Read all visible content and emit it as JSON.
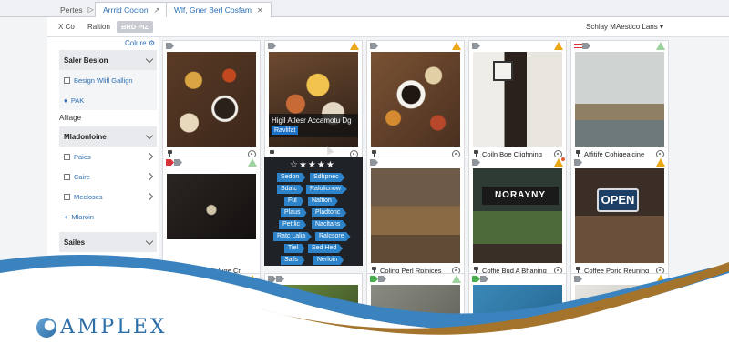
{
  "tabs": [
    {
      "label": "Pertes",
      "icon": "forward-icon"
    },
    {
      "label": "Arrrid Cocion",
      "icon": "forward-icon"
    },
    {
      "label": "Wlf, Gner Berl Cosfam",
      "icon": "close-icon"
    }
  ],
  "toolbar": {
    "undo_label": "X Co",
    "ration_label": "Raition",
    "pill_label": "BRD PIZ",
    "sort_label": "Schlay MAestico Lans"
  },
  "sidebar": {
    "top_link": "Colure",
    "panel1": {
      "title": "Saler Besion",
      "items": [
        {
          "label": "Besign Wlifl Gallign"
        },
        {
          "label": "PAK"
        }
      ]
    },
    "section_label": "Alliage",
    "panel2": {
      "title": "Mladonloine",
      "items": [
        {
          "label": "Paies"
        },
        {
          "label": "Caire"
        },
        {
          "label": "Mecloses"
        },
        {
          "label": "Mlaroin"
        }
      ]
    },
    "panel3": {
      "title": "Sailes"
    }
  },
  "cards": [
    {
      "caption": "",
      "photo": "food"
    },
    {
      "caption": "",
      "photo": "food2",
      "overlay_title": "Higil Atlesr Accamotu Dg",
      "overlay_tag": "Ravlifat"
    },
    {
      "caption": "",
      "photo": "coffee"
    },
    {
      "caption": "Coiln Boe Clighning",
      "photo": "woman"
    },
    {
      "caption": "Affitife Cohigealcine",
      "photo": "cliff"
    },
    {
      "caption": "Pstisng Compluge Cr",
      "photo": "dark"
    },
    {
      "caption": "Coling Perl Rpinices",
      "photo": "interior"
    },
    {
      "caption": "Coffie Bud A Bhaning",
      "photo": "plants",
      "sign": "NORAYNY"
    },
    {
      "caption": "Coffee Poric Reuning",
      "photo": "open",
      "sign": "OPEN"
    }
  ],
  "edit_tags": {
    "stars": "☆★★★★",
    "pills": [
      "Sedon",
      "Sdhpnec",
      "Sdatc",
      "Ralolicnow",
      "Ful",
      "Naltion",
      "Plaus",
      "Pladtonc",
      "Pettlic",
      "Nacltans",
      "Ratc Lalia",
      "Ralcsore",
      "Tiel",
      "Sed Hed",
      "Salls",
      "Nerloin"
    ]
  },
  "brand": {
    "name": "AMPLEX"
  },
  "colors": {
    "accent": "#2d6fb3",
    "warn": "#e9a916",
    "wave_blue": "#3b83bf",
    "wave_gold": "#a4742c"
  }
}
